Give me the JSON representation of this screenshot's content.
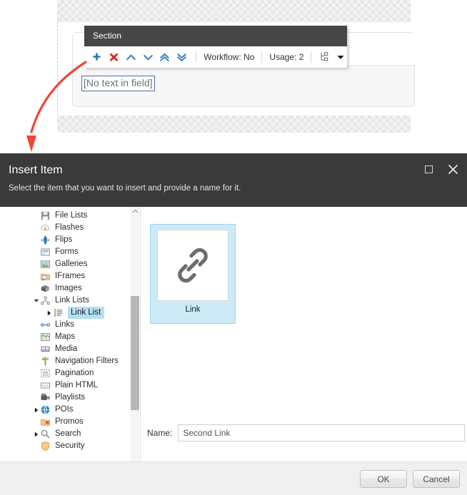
{
  "canvas": {
    "section_popup": {
      "title": "Section",
      "toolbar": {
        "add_icon": "plus-icon",
        "delete_icon": "delete-x-icon",
        "move_up_icon": "chevron-up-icon",
        "move_down_icon": "chevron-down-icon",
        "move_top_icon": "double-chevron-up-icon",
        "move_bottom_icon": "double-chevron-down-icon",
        "workflow_text": "Workflow: No",
        "usage_text": "Usage: 2",
        "structure_icon": "sitemap-icon",
        "dropdown_icon": "caret-down-icon"
      }
    },
    "placeholder_field_text": "[No text in field]",
    "annotation": {
      "arrow_icon": "red-arrow-annotation",
      "color": "#f44336"
    }
  },
  "dialog": {
    "title": "Insert Item",
    "subtitle": "Select the item that you want to insert and provide a name for it.",
    "window_buttons": {
      "maximize_icon": "maximize-icon",
      "close_icon": "close-icon"
    },
    "tree": {
      "items": [
        {
          "label": "File Lists",
          "icon": "file-lists-icon",
          "indent": 1,
          "arrow": "",
          "selected": false
        },
        {
          "label": "Flashes",
          "icon": "flashes-icon",
          "indent": 1,
          "arrow": "",
          "selected": false
        },
        {
          "label": "Flips",
          "icon": "flips-icon",
          "indent": 1,
          "arrow": "",
          "selected": false
        },
        {
          "label": "Forms",
          "icon": "forms-icon",
          "indent": 1,
          "arrow": "",
          "selected": false
        },
        {
          "label": "Galleries",
          "icon": "galleries-icon",
          "indent": 1,
          "arrow": "",
          "selected": false
        },
        {
          "label": "IFrames",
          "icon": "iframes-icon",
          "indent": 1,
          "arrow": "",
          "selected": false
        },
        {
          "label": "Images",
          "icon": "images-icon",
          "indent": 1,
          "arrow": "",
          "selected": false
        },
        {
          "label": "Link Lists",
          "icon": "link-lists-icon",
          "indent": 1,
          "arrow": "expanded",
          "selected": false
        },
        {
          "label": "Link List",
          "icon": "link-list-icon",
          "indent": 2,
          "arrow": "collapsed",
          "selected": true
        },
        {
          "label": "Links",
          "icon": "links-icon",
          "indent": 1,
          "arrow": "",
          "selected": false
        },
        {
          "label": "Maps",
          "icon": "maps-icon",
          "indent": 1,
          "arrow": "",
          "selected": false
        },
        {
          "label": "Media",
          "icon": "media-icon",
          "indent": 1,
          "arrow": "",
          "selected": false
        },
        {
          "label": "Navigation Filters",
          "icon": "navigation-filters-icon",
          "indent": 1,
          "arrow": "",
          "selected": false
        },
        {
          "label": "Pagination",
          "icon": "pagination-icon",
          "indent": 1,
          "arrow": "",
          "selected": false
        },
        {
          "label": "Plain HTML",
          "icon": "plain-html-icon",
          "indent": 1,
          "arrow": "",
          "selected": false
        },
        {
          "label": "Playlists",
          "icon": "playlists-icon",
          "indent": 1,
          "arrow": "",
          "selected": false
        },
        {
          "label": "POIs",
          "icon": "pois-icon",
          "indent": 1,
          "arrow": "collapsed",
          "selected": false
        },
        {
          "label": "Promos",
          "icon": "promos-icon",
          "indent": 1,
          "arrow": "",
          "selected": false
        },
        {
          "label": "Search",
          "icon": "search-icon",
          "indent": 1,
          "arrow": "collapsed",
          "selected": false
        },
        {
          "label": "Security",
          "icon": "security-icon",
          "indent": 1,
          "arrow": "",
          "selected": false
        }
      ],
      "scrollbar": {
        "up_arrow_icon": "scroll-up-arrow-icon"
      }
    },
    "items_panel": {
      "cards": [
        {
          "label": "Link",
          "icon": "link-chain-icon",
          "selected": true
        }
      ],
      "name_label": "Name:",
      "name_value": "Second Link",
      "name_placeholder": ""
    },
    "footer": {
      "ok_label": "OK",
      "cancel_label": "Cancel"
    }
  }
}
